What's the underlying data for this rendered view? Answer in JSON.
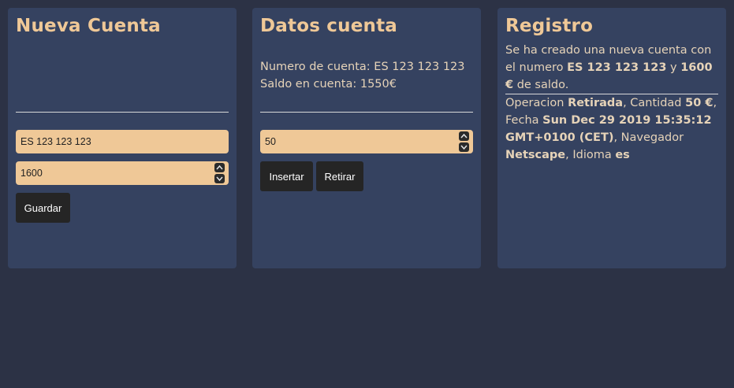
{
  "nueva_cuenta": {
    "title": "Nueva Cuenta",
    "account_input_value": "ES 123 123 123",
    "amount_input_value": "1600",
    "save_label": "Guardar"
  },
  "datos_cuenta": {
    "title": "Datos cuenta",
    "account_line": "Numero de cuenta: ES 123 123 123",
    "balance_line": "Saldo en cuenta: 1550€",
    "amount_input_value": "50",
    "insert_label": "Insertar",
    "withdraw_label": "Retirar"
  },
  "registro": {
    "title": "Registro",
    "entry1": {
      "t1": "Se ha creado una nueva cuenta con el numero ",
      "account": "ES 123 123 123",
      "t2": " y ",
      "amount": "1600 €",
      "t3": " de saldo."
    },
    "entry2": {
      "t1": "Operacion ",
      "operation": "Retirada",
      "t2": ", Cantidad ",
      "amount": "50 €",
      "t3": ", Fecha ",
      "date": "Sun Dec 29 2019 15:35:12 GMT+0100 (CET)",
      "t4": ", Navegador ",
      "browser": "Netscape",
      "t5": ", Idioma ",
      "language": "es"
    }
  }
}
